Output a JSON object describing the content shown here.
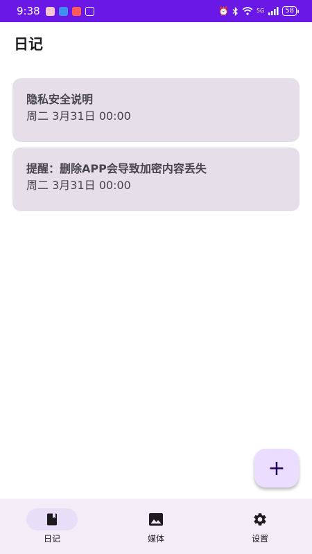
{
  "status_bar": {
    "time": "9:38",
    "network": "5G",
    "battery": "58"
  },
  "header": {
    "title": "日记"
  },
  "entries": [
    {
      "title": "隐私安全说明",
      "date": "周二 3月31日 00:00"
    },
    {
      "title": "提醒：删除APP会导致加密内容丢失",
      "date": "周二 3月31日 00:00"
    }
  ],
  "fab": {
    "icon": "add-icon",
    "label": "+"
  },
  "bottom_nav": {
    "items": [
      {
        "label": "日记",
        "icon": "book-icon",
        "active": true
      },
      {
        "label": "媒体",
        "icon": "image-icon",
        "active": false
      },
      {
        "label": "设置",
        "icon": "gear-icon",
        "active": false
      }
    ]
  },
  "colors": {
    "status_bar": "#6a18e6",
    "card_bg": "#e6dfea",
    "fab_bg": "#eaddff",
    "nav_bg": "#f3edf7",
    "nav_active": "#e8def8"
  }
}
